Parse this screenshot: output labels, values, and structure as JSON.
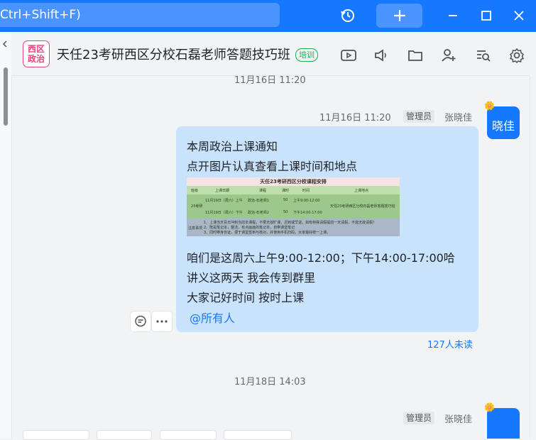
{
  "search": {
    "text": "Ctrl+Shift+F)"
  },
  "header": {
    "avatar_text": "西区\n政治",
    "avatar_line1": "西区",
    "avatar_line2": "政治",
    "title": "天任23考研西区分校石磊老师答题技巧班",
    "tag": "培训"
  },
  "chat": {
    "timestamp_top": "11月16日 11:20",
    "message": {
      "time": "11月16日 11:20",
      "role": "管理员",
      "sender": "张晓佳",
      "avatar_text": "晓佳",
      "line1": "本周政治上课通知",
      "line2": "点开图片认真查看上课时间和地点",
      "line3": "咱们是这周六上午9:00-12:00；下午14:00-17:00哈",
      "line4": "讲义这两天 我会传到群里",
      "line5": "大家记好时间 按时上课",
      "mention": "@所有人",
      "unread": "127人未读"
    },
    "schedule_image": {
      "title": "天任23考研西区分校课程安排",
      "headers": [
        "班级",
        "上课日期",
        "课程",
        "课时",
        "时间",
        "上课地点"
      ],
      "class": "23考研",
      "rows": [
        [
          "11月19日（周六）上午",
          "政治-石老师1",
          "50",
          "上午9:00-12:00"
        ],
        [
          "11月19日（周六）下午",
          "政治-石老师2",
          "50",
          "下午14:00-17:00"
        ]
      ],
      "location": "天任23考研西区分校石磊老师答题技巧班",
      "notes_label": "注意事项",
      "notes": [
        "1、上课当天百日冲刺当前本课程，不要无故旷课，迟到或早退，如有特殊请假提前一天请假，不能无故请假！",
        "2、既是笔记本，整洁，有点画画的笔记本，自带课堂笔记",
        "3、同时带身份证，便于课堂签到与核对，并使用手机扫码，大家最好统一上课。"
      ]
    },
    "timestamp_bottom": "11月18日 14:03",
    "next_message": {
      "role": "管理员",
      "sender": "张晓佳"
    }
  },
  "colors": {
    "accent": "#1677ff",
    "bubble": "#c9e3fc",
    "tag": "#19b24a",
    "group_avatar": "#e9447a"
  }
}
